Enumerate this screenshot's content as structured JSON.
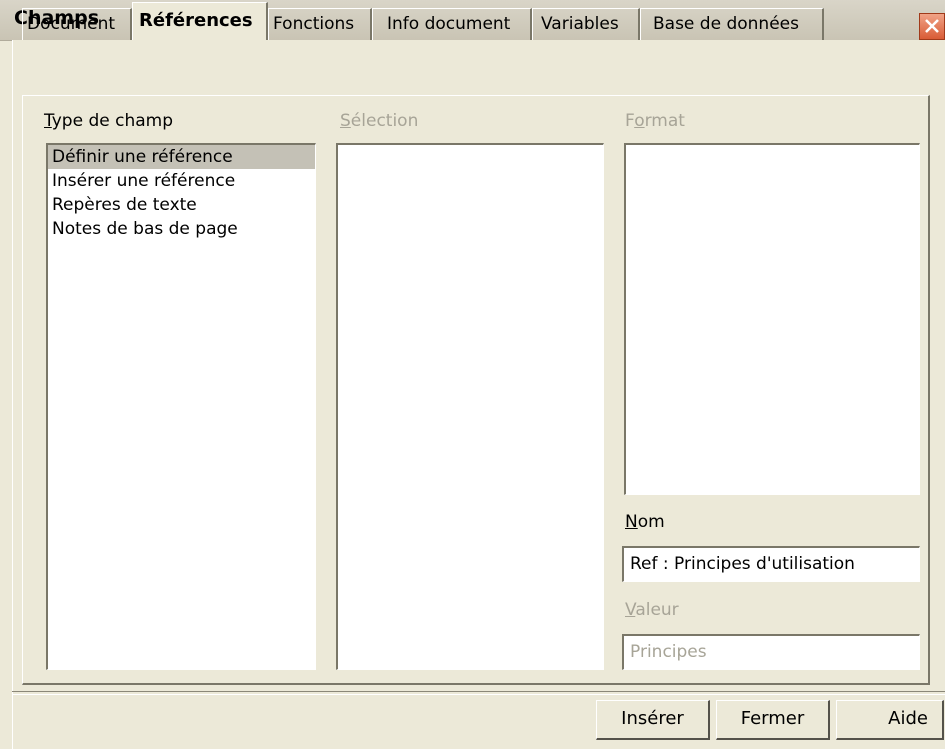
{
  "window": {
    "title": "Champs"
  },
  "tabs": [
    {
      "label": "Document",
      "active": false
    },
    {
      "label": "Références",
      "active": true
    },
    {
      "label": "Fonctions",
      "active": false
    },
    {
      "label": "Info document",
      "active": false
    },
    {
      "label": "Variables",
      "active": false
    },
    {
      "label": "Base de données",
      "active": false
    }
  ],
  "type_de_champ": {
    "label_prefix": "T",
    "label_rest": "ype de champ",
    "items": [
      "Définir une référence",
      "Insérer une référence",
      "Repères de texte",
      "Notes de bas de page"
    ],
    "selected_index": 0
  },
  "selection": {
    "label_prefix": "S",
    "label_rest": "élection"
  },
  "format": {
    "label_prefix": "F",
    "label_u": "o",
    "label_rest": "rmat"
  },
  "nom": {
    "label_prefix": "N",
    "label_rest": "om",
    "value": "Ref : Principes d'utilisation"
  },
  "valeur": {
    "label_prefix": "V",
    "label_rest": "aleur",
    "value": "Principes"
  },
  "buttons": {
    "insert": "Insérer",
    "close": "Fermer",
    "help": "Aide"
  }
}
